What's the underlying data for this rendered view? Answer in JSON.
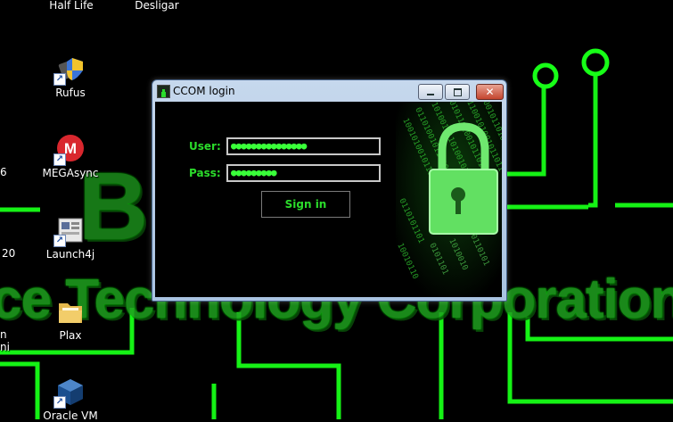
{
  "desktop": {
    "icons": [
      {
        "label": "Half Life",
        "icon": "half-life-icon"
      },
      {
        "label": "Desligar",
        "icon": "shutdown-icon"
      },
      {
        "label": "Rufus",
        "icon": "rufus-icon"
      },
      {
        "label": "MEGAsync",
        "icon": "megasync-icon"
      },
      {
        "label": "Launch4j",
        "icon": "launch4j-icon"
      },
      {
        "label": "Plax",
        "icon": "folder-icon"
      },
      {
        "label": "Oracle VM",
        "icon": "virtualbox-icon"
      }
    ],
    "edge_fragments": [
      "6",
      "20",
      "n",
      "ni"
    ],
    "wallpaper": {
      "big_letters": "BL",
      "tagline": "ce Technology Corporation",
      "accent_color": "#00ff00"
    }
  },
  "window": {
    "title": "CCOM login",
    "controls": {
      "minimize_icon": "minimize-icon",
      "maximize_icon": "maximize-icon",
      "close_icon": "close-icon"
    },
    "user_label": "User:",
    "user_value": "●●●●●●●●●●●●●●●",
    "pass_label": "Pass:",
    "pass_value": "●●●●●●●●●",
    "signin_label": "Sign in",
    "colors": {
      "label_green": "#2bdc2b",
      "field_text": "#39ff39",
      "background": "#000000"
    }
  }
}
